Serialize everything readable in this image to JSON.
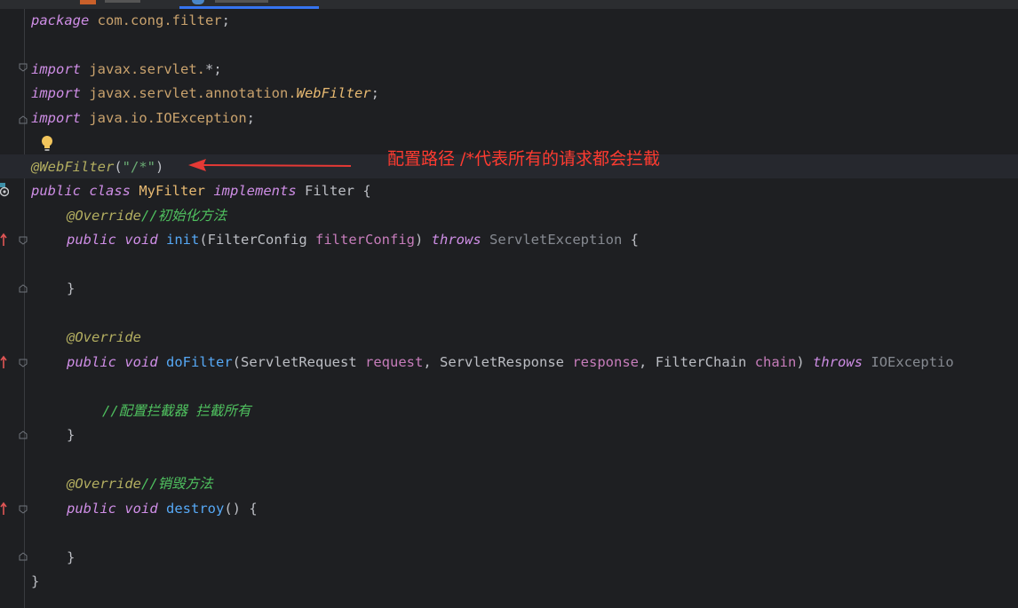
{
  "tabs": [
    {
      "label": "",
      "active": false
    },
    {
      "label": "",
      "active": true
    }
  ],
  "code": {
    "l1_kw": "package",
    "l1_pkg": "com.cong.filter",
    "l1_semi": ";",
    "l3_kw": "import",
    "l3_path": "javax.servlet.",
    "l3_star": "*;",
    "l4_kw": "import",
    "l4_path": "javax.servlet.annotation.",
    "l4_cls": "WebFilter",
    "l4_semi": ";",
    "l5_kw": "import",
    "l5_path": "java.io.",
    "l5_cls": "IOException",
    "l5_semi": ";",
    "l7_ann": "@WebFilter",
    "l7_open": "(",
    "l7_str": "\"/*\"",
    "l7_close": ")",
    "l8_kw1": "public class",
    "l8_name": "MyFilter",
    "l8_kw2": "implements",
    "l8_iface": "Filter",
    "l8_brace": "{",
    "l9_ann": "@Override",
    "l9_cmt": "//初始化方法",
    "l10_kw": "public void",
    "l10_fn": "init",
    "l10_open": "(",
    "l10_type": "FilterConfig",
    "l10_param": "filterConfig",
    "l10_close": ")",
    "l10_throws": "throws",
    "l10_exc": "ServletException",
    "l10_brace": "{",
    "l12_brace": "}",
    "l14_ann": "@Override",
    "l15_kw": "public void",
    "l15_fn": "doFilter",
    "l15_open": "(",
    "l15_t1": "ServletRequest",
    "l15_p1": "request",
    "l15_c1": ",",
    "l15_t2": "ServletResponse",
    "l15_p2": "response",
    "l15_c2": ",",
    "l15_t3": "FilterChain",
    "l15_p3": "chain",
    "l15_close": ")",
    "l15_throws": "throws",
    "l15_exc": "IOExceptio",
    "l17_cmt": "//配置拦截器 拦截所有",
    "l18_brace": "}",
    "l20_ann": "@Override",
    "l20_cmt": "//销毁方法",
    "l21_kw": "public void",
    "l21_fn": "destroy",
    "l21_parens": "()",
    "l21_brace": "{",
    "l23_brace": "}",
    "l24_brace": "}"
  },
  "annotation_note": "配置路径 /*代表所有的请求都会拦截",
  "colors": {
    "background": "#1e1f22",
    "keyword": "#cf8ee6",
    "annotation": "#b3ae60",
    "string": "#6aab73",
    "function": "#56a8f5",
    "comment": "#4fc15f",
    "note": "#ff3b30"
  },
  "icons": {
    "bulb": "lightbulb-icon",
    "class": "class-icon",
    "override": "override-arrow-icon",
    "fold": "fold-icon"
  }
}
